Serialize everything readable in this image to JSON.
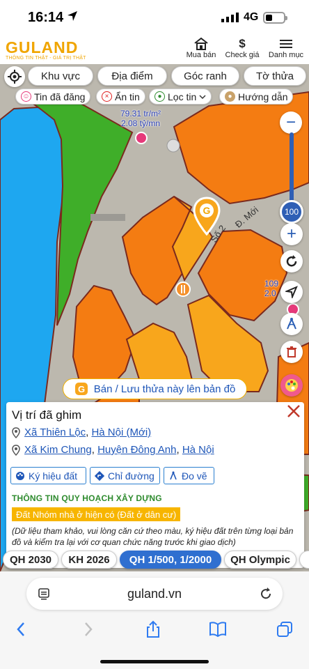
{
  "status": {
    "time": "16:14",
    "network": "4G"
  },
  "header": {
    "logo": "GULAND",
    "logo_sub": "THÔNG TIN THẬT - GIÁ TRỊ THẬT",
    "buy": "Mua bán",
    "price_check": "Check giá",
    "menu": "Danh mục"
  },
  "filters": [
    "Khu vực",
    "Địa điểm",
    "Góc ranh",
    "Tờ thửa"
  ],
  "chips": {
    "posted": "Tin đã đăng",
    "hide": "Ẩn tin",
    "filter": "Lọc tin",
    "guide": "Hướng dẫn"
  },
  "map": {
    "price_a": {
      "line1": "79.31 tr/m²",
      "line2": "2.08 tỷ/mn"
    },
    "price_b": {
      "line1": "109",
      "line2": "2.0"
    },
    "street_so2": "Số 2",
    "street_moi": "Đ. Mới",
    "zoom_level": "100",
    "colors": {
      "water": "#1ea7f0",
      "green": "#3fae29",
      "orange": "#f47c12",
      "yellow": "#f8a61c",
      "road": "#b8b5ad"
    }
  },
  "sell_button": "Bán / Lưu thửa này lên bản đồ",
  "panel": {
    "title": "Vị trí đã ghim",
    "addr1": {
      "commune": "Xã Thiên Lộc",
      "sep": ",",
      "city": "Hà Nội (Mới)"
    },
    "addr2": {
      "commune": "Xã Kim Chung",
      "sep1": ",",
      "district": "Huyện Đông Anh",
      "sep2": ",",
      "city": "Hà Nội"
    },
    "tools": {
      "symbols": "Ký hiệu đất",
      "directions": "Chỉ đường",
      "measure": "Đo vẽ"
    },
    "section": "THÔNG TIN QUY HOẠCH XÂY DỰNG",
    "land_type": "Đất Nhóm nhà ở hiện có (Đất ở dân cư)",
    "note": "(Dữ liệu tham khảo, vui lòng căn cứ theo màu, ký hiệu đất trên từng loại bản đồ và kiểm tra lại với cơ quan chức năng trước khi giao dịch)"
  },
  "plans": [
    "QH 2030",
    "KH 2026",
    "QH 1/500, 1/2000",
    "QH Olympic"
  ],
  "browser": {
    "url": "guland.vn"
  }
}
